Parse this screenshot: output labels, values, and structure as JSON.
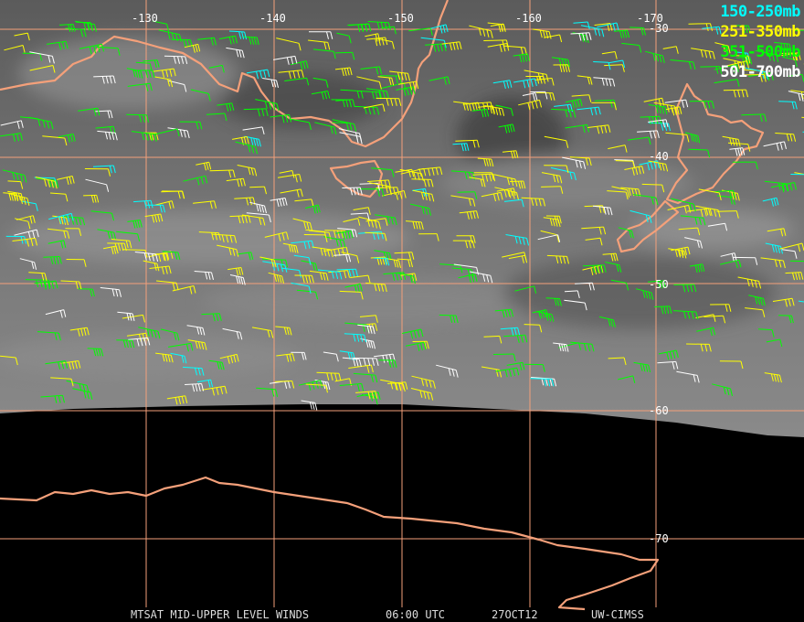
{
  "legend": [
    {
      "label": "150-250mb",
      "color": "#00ffff"
    },
    {
      "label": "251-350mb",
      "color": "#ffff00"
    },
    {
      "label": "351-500mb",
      "color": "#00ff00"
    },
    {
      "label": "501-700mb",
      "color": "#ffffff"
    }
  ],
  "grid": {
    "longitudes": [
      "-130",
      "-140",
      "-150",
      "-160",
      "-170"
    ],
    "latitudes": [
      "-30",
      "-40",
      "-50",
      "-60",
      "-70"
    ],
    "line_color": "#f4a07a"
  },
  "colors": {
    "coastline": "#f4a07a",
    "sky": "#6e6e6e",
    "space": "#000000"
  },
  "footer": {
    "product": "MTSAT MID-UPPER LEVEL WINDS",
    "time": "06:00 UTC",
    "date": "27OCT12",
    "source": "UW-CIMSS"
  }
}
